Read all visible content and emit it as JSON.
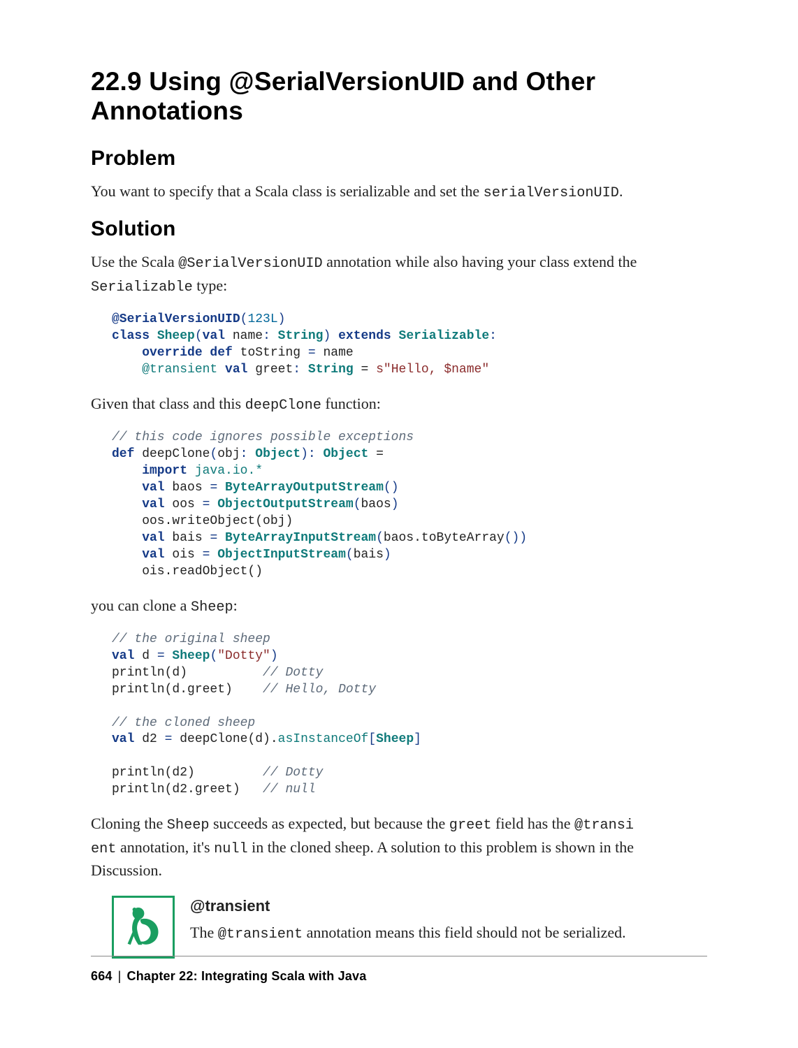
{
  "title": "22.9 Using @SerialVersionUID and Other Annotations",
  "sections": {
    "problem": {
      "heading": "Problem",
      "intro_before": "You want to specify that a Scala class is serializable and set the ",
      "intro_code": "serialVersionUID",
      "intro_after": "."
    },
    "solution": {
      "heading": "Solution",
      "p1_before": "Use the Scala ",
      "p1_code": "@SerialVersionUID",
      "p1_mid": " annotation while also having your class extend the ",
      "p1_code2": "Serializable",
      "p1_after": " type:",
      "code1": {
        "l1a": "@SerialVersionUID",
        "l1b": "(",
        "l1c": "123L",
        "l1d": ")",
        "l2a": "class",
        "l2b": " Sheep",
        "l2c": "(",
        "l2d": "val",
        "l2e": " name",
        "l2f": ": ",
        "l2g": "String",
        "l2h": ")",
        "l2i": " extends",
        "l2j": " Serializable",
        "l2k": ":",
        "l3a": "    override",
        "l3b": " def",
        "l3c": " toString ",
        "l3d": "=",
        "l3e": " name",
        "l4a": "    ",
        "l4b": "@transient",
        "l4c": " val",
        "l4d": " greet",
        "l4e": ": ",
        "l4f": "String",
        "l4g": " = ",
        "l4h": "s\"Hello, $name\""
      },
      "p2_before": "Given that class and this ",
      "p2_code": "deepClone",
      "p2_after": " function:",
      "code2": {
        "l1": "// this code ignores possible exceptions",
        "l2a": "def",
        "l2b": " deepClone",
        "l2c": "(",
        "l2d": "obj",
        "l2e": ": ",
        "l2f": "Object",
        "l2g": "):",
        "l2h": " Object",
        "l2i": " =",
        "l3a": "    import",
        "l3b": " java.io.*",
        "l4a": "    val",
        "l4b": " baos ",
        "l4c": "=",
        "l4d": " ByteArrayOutputStream",
        "l4e": "()",
        "l5a": "    val",
        "l5b": " oos ",
        "l5c": "=",
        "l5d": " ObjectOutputStream",
        "l5e": "(",
        "l5f": "baos",
        "l5g": ")",
        "l6": "    oos.writeObject(obj)",
        "l7a": "    val",
        "l7b": " bais ",
        "l7c": "=",
        "l7d": " ByteArrayInputStream",
        "l7e": "(",
        "l7f": "baos.toByteArray",
        "l7g": "())",
        "l8a": "    val",
        "l8b": " ois ",
        "l8c": "=",
        "l8d": " ObjectInputStream",
        "l8e": "(",
        "l8f": "bais",
        "l8g": ")",
        "l9": "    ois.readObject()"
      },
      "p3_before": "you can clone a ",
      "p3_code": "Sheep",
      "p3_after": ":",
      "code3": {
        "l1": "// the original sheep",
        "l2a": "val",
        "l2b": " d ",
        "l2c": "=",
        "l2d": " Sheep",
        "l2e": "(",
        "l2f": "\"Dotty\"",
        "l2g": ")",
        "l3a": "println(d)          ",
        "l3b": "// Dotty",
        "l4a": "println(d.greet)    ",
        "l4b": "// Hello, Dotty",
        "l5": "",
        "l6": "// the cloned sheep",
        "l7a": "val",
        "l7b": " d2 ",
        "l7c": "=",
        "l7d": " deepClone(d).",
        "l7e": "asInstanceOf",
        "l7f": "[",
        "l7g": "Sheep",
        "l7h": "]",
        "l8": "",
        "l9a": "println(d2)         ",
        "l9b": "// Dotty",
        "l10a": "println(d2.greet)   ",
        "l10b": "// null"
      },
      "p4_t1": "Cloning the ",
      "p4_c1": "Sheep",
      "p4_t2": " succeeds as expected, but because the ",
      "p4_c2": "greet",
      "p4_t3": " field has the ",
      "p4_c3a": "@transi",
      "p4_c3b": "ent",
      "p4_t4": " annotation, it's ",
      "p4_c4": "null",
      "p4_t5": " in the cloned sheep. A solution to this problem is shown in the Discussion."
    },
    "note": {
      "title": "@transient",
      "text_before": "The ",
      "text_code": "@transient",
      "text_after": " annotation means this field should not be serialized."
    }
  },
  "footer": {
    "page": "664",
    "chapter": "Chapter 22: Integrating Scala with Java"
  }
}
